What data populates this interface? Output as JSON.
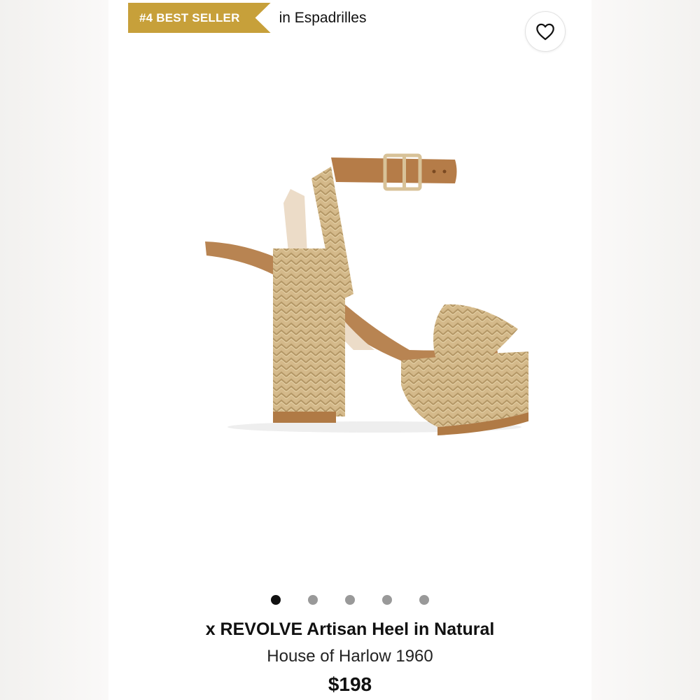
{
  "badge": {
    "rank_label": "#4 BEST SELLER",
    "category": "in Espadrilles",
    "color": "#c7a03a"
  },
  "wishlist": {
    "icon": "heart-outline-icon"
  },
  "carousel": {
    "count": 5,
    "active_index": 0
  },
  "product": {
    "title": "x REVOLVE Artisan Heel in Natural",
    "brand": "House of Harlow 1960",
    "price": "$198"
  }
}
